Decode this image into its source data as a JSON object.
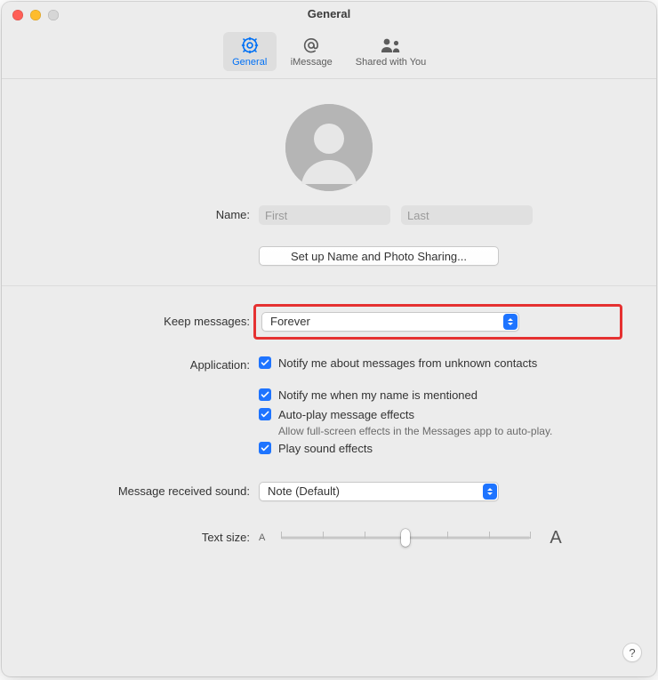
{
  "window": {
    "title": "General"
  },
  "toolbar": {
    "items": [
      {
        "label": "General",
        "icon": "gear-icon",
        "active": true
      },
      {
        "label": "iMessage",
        "icon": "at-icon",
        "active": false
      },
      {
        "label": "Shared with You",
        "icon": "people-icon",
        "active": false
      }
    ]
  },
  "profile": {
    "name_label": "Name:",
    "first_placeholder": "First",
    "last_placeholder": "Last",
    "first_value": "",
    "last_value": "",
    "setup_button": "Set up Name and Photo Sharing..."
  },
  "settings": {
    "keep_label": "Keep messages:",
    "keep_value": "Forever",
    "application_label": "Application:",
    "checks": [
      {
        "label": "Notify me about messages from unknown contacts",
        "checked": true
      },
      {
        "label": "Notify me when my name is mentioned",
        "checked": true
      },
      {
        "label": "Auto-play message effects",
        "checked": true,
        "sub": "Allow full-screen effects in the Messages app to auto-play."
      },
      {
        "label": "Play sound effects",
        "checked": true
      }
    ],
    "sound_label": "Message received sound:",
    "sound_value": "Note (Default)",
    "textsize_label": "Text size:",
    "textsize_small_glyph": "A",
    "textsize_big_glyph": "A",
    "textsize_ticks": 7,
    "textsize_position": 3
  },
  "help_glyph": "?"
}
